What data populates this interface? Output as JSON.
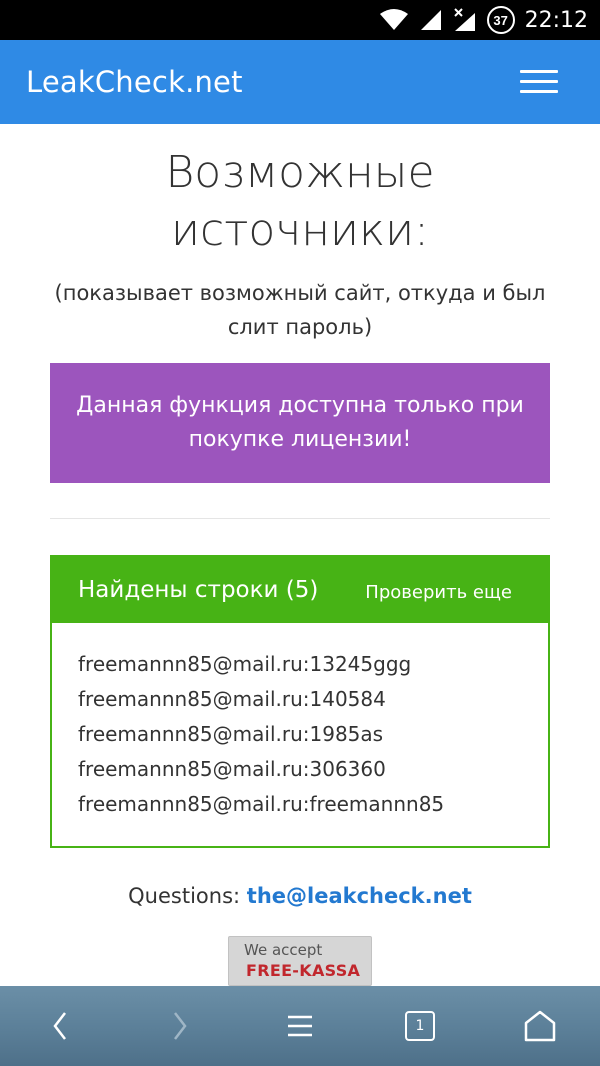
{
  "status_bar": {
    "time": "22:12",
    "battery": "37",
    "icons": [
      "wifi-icon",
      "signal-icon",
      "no-data-signal-icon",
      "battery-icon"
    ]
  },
  "app_bar": {
    "brand": "LeakCheck.net",
    "menu_icon": "hamburger-icon",
    "color": "#2f8ae5"
  },
  "page": {
    "title_line1": "Возможные",
    "title_line2": "источники:",
    "subtitle_line1": "(показывает возможный сайт, откуда и был",
    "subtitle_line2": "слит пароль)"
  },
  "license_notice": {
    "line1": "Данная функция доступна только при",
    "line2": "покупке лицензии!",
    "color": "#9c55bd"
  },
  "results": {
    "title": "Найдены строки (5)",
    "check_again": "Проверить еще",
    "color": "#47b315",
    "rows": [
      "freemannn85@mail.ru:13245ggg",
      "freemannn85@mail.ru:140584",
      "freemannn85@mail.ru:1985as",
      "freemannn85@mail.ru:306360",
      "freemannn85@mail.ru:freemannn85"
    ]
  },
  "footer": {
    "questions_label": "Questions:",
    "email": "the@leakcheck.net",
    "badge_line1": "We accept",
    "badge_line2": "FREE-KASSA"
  },
  "browser_nav": {
    "tab_count": "1",
    "icons": [
      "back-icon",
      "forward-icon",
      "menu-icon",
      "tabs-icon",
      "home-icon"
    ]
  }
}
